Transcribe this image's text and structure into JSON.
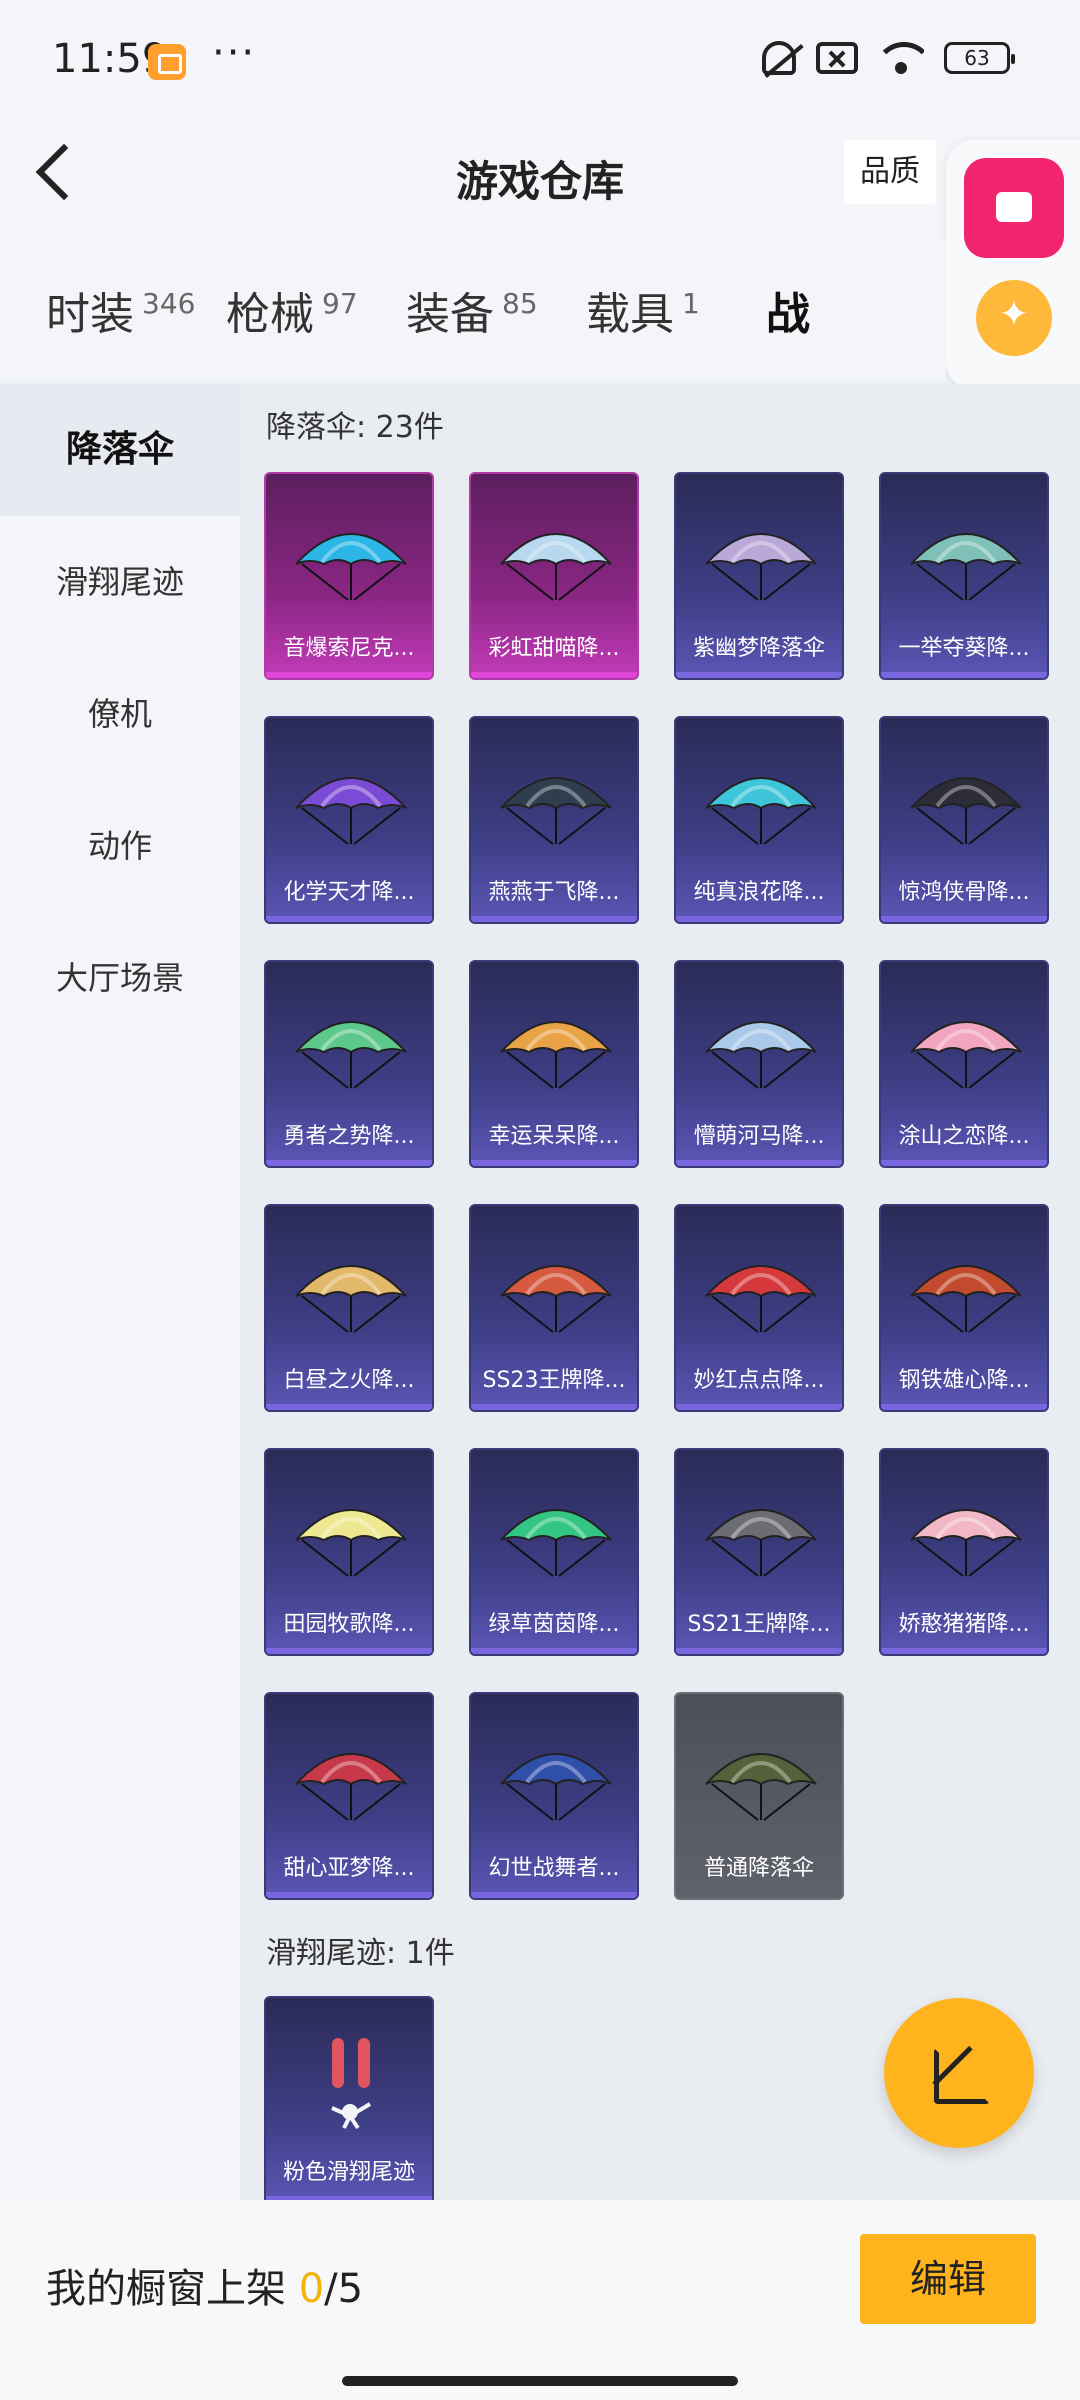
{
  "status_bar": {
    "time": "11:59",
    "dots": "···",
    "battery": "63",
    "icons": [
      "notification-badge-icon",
      "mute-bell-icon",
      "close-box-icon",
      "wifi-icon",
      "battery-icon"
    ]
  },
  "header": {
    "title": "游戏仓库",
    "quality_label": "品质"
  },
  "tabs": [
    {
      "label": "时装",
      "count": "346"
    },
    {
      "label": "枪械",
      "count": "97"
    },
    {
      "label": "装备",
      "count": "85"
    },
    {
      "label": "载具",
      "count": "1"
    },
    {
      "label": "战",
      "count": ""
    }
  ],
  "sidebar": {
    "items": [
      {
        "label": "降落伞"
      },
      {
        "label": "滑翔尾迹"
      },
      {
        "label": "僚机"
      },
      {
        "label": "动作"
      },
      {
        "label": "大厅场景"
      }
    ]
  },
  "sections": [
    {
      "label": "降落伞: 23件"
    },
    {
      "label": "滑翔尾迹: 1件"
    }
  ],
  "parachutes": [
    {
      "name": "音爆索尼克...",
      "rarity": "pink",
      "color": "#2bb6e6"
    },
    {
      "name": "彩虹甜喵降...",
      "rarity": "pink",
      "color": "#b7d8ef"
    },
    {
      "name": "紫幽梦降落伞",
      "rarity": "purple",
      "color": "#b9a8d8"
    },
    {
      "name": "一举夺葵降...",
      "rarity": "purple",
      "color": "#7fc1b8"
    },
    {
      "name": "化学天才降...",
      "rarity": "purple",
      "color": "#7b4bd6"
    },
    {
      "name": "燕燕于飞降...",
      "rarity": "purple",
      "color": "#2f3e4f"
    },
    {
      "name": "纯真浪花降...",
      "rarity": "purple",
      "color": "#3fc5d9"
    },
    {
      "name": "惊鸿侠骨降...",
      "rarity": "purple",
      "color": "#2d2d3a"
    },
    {
      "name": "勇者之势降...",
      "rarity": "purple",
      "color": "#5cc88a"
    },
    {
      "name": "幸运呆呆降...",
      "rarity": "purple",
      "color": "#e9a347"
    },
    {
      "name": "懵萌河马降...",
      "rarity": "purple",
      "color": "#aac8ea"
    },
    {
      "name": "涂山之恋降...",
      "rarity": "purple",
      "color": "#f1a5c0"
    },
    {
      "name": "白昼之火降...",
      "rarity": "purple",
      "color": "#e2b86b"
    },
    {
      "name": "SS23王牌降...",
      "rarity": "purple",
      "color": "#d65a3f"
    },
    {
      "name": "妙红点点降...",
      "rarity": "purple",
      "color": "#d6393c"
    },
    {
      "name": "钢铁雄心降...",
      "rarity": "purple",
      "color": "#c24a2e"
    },
    {
      "name": "田园牧歌降...",
      "rarity": "purple",
      "color": "#efe892"
    },
    {
      "name": "绿草茵茵降...",
      "rarity": "purple",
      "color": "#32c584"
    },
    {
      "name": "SS21王牌降...",
      "rarity": "purple",
      "color": "#6b6d73"
    },
    {
      "name": "娇憨猪猪降...",
      "rarity": "purple",
      "color": "#f2b7c7"
    },
    {
      "name": "甜心亚梦降...",
      "rarity": "purple",
      "color": "#c7394a"
    },
    {
      "name": "幻世战舞者...",
      "rarity": "purple",
      "color": "#2f4fa8"
    },
    {
      "name": "普通降落伞",
      "rarity": "gray",
      "color": "#55613a"
    }
  ],
  "trails": [
    {
      "name": "粉色滑翔尾迹",
      "rarity": "purple",
      "color": "#e0555f"
    }
  ],
  "bottom": {
    "shelf_prefix": "我的橱窗上架 ",
    "shelf_num": "0",
    "shelf_total": "/5",
    "edit_label": "编辑"
  },
  "colors": {
    "accent": "#ffb41e",
    "pink_badge": "#f2246f",
    "purple_card": "#3e3e86",
    "pink_card": "#8b2684"
  }
}
